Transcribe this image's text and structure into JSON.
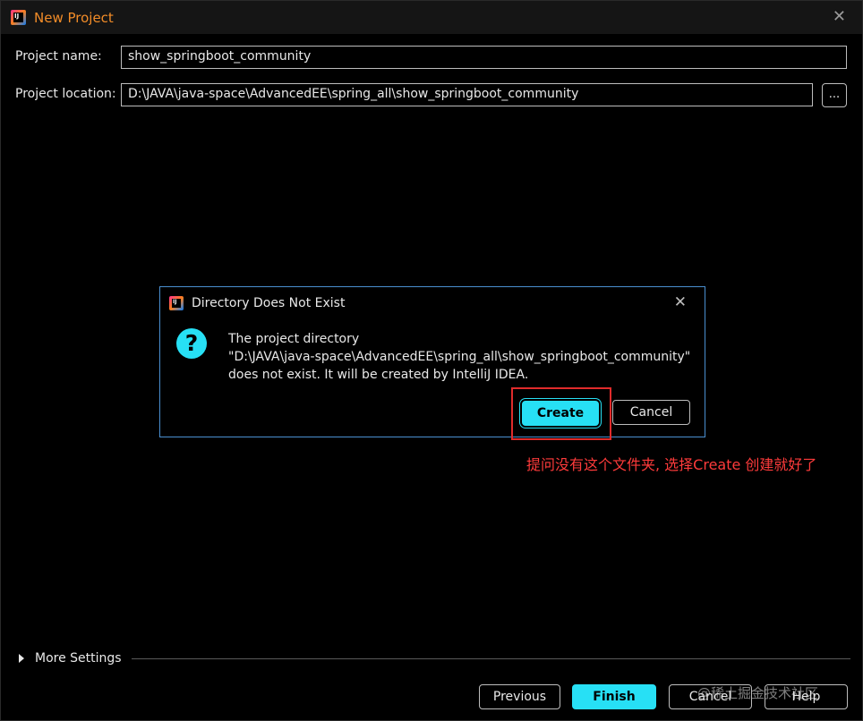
{
  "window": {
    "title": "New Project",
    "icon_label": "IJ",
    "close_symbol": "✕"
  },
  "form": {
    "project_name_label": "Project name:",
    "project_name_value": "show_springboot_community",
    "project_location_label": "Project location:",
    "project_location_value": "D:\\JAVA\\java-space\\AdvancedEE\\spring_all\\show_springboot_community",
    "browse_label": "..."
  },
  "more_settings": {
    "label": "More Settings"
  },
  "footer": {
    "previous_label": "Previous",
    "finish_label": "Finish",
    "cancel_label": "Cancel",
    "help_label": "Help"
  },
  "dialog": {
    "title": "Directory Does Not Exist",
    "icon_label": "IJ",
    "close_symbol": "✕",
    "question_symbol": "?",
    "message_line1": "The project directory",
    "message_line2": "\"D:\\JAVA\\java-space\\AdvancedEE\\spring_all\\show_springboot_community\"",
    "message_line3": "does not exist. It will be created by IntelliJ IDEA.",
    "create_label": "Create",
    "cancel_label": "Cancel"
  },
  "annotation": {
    "text": "提问没有这个文件夹, 选择Create 创建就好了"
  },
  "watermark": {
    "text": "@稀土掘金技术社区"
  },
  "colors": {
    "accent": "#27e0f5",
    "title_orange": "#f28c28",
    "annotation_red": "#e02b2b",
    "dialog_border": "#4a8fd0"
  }
}
